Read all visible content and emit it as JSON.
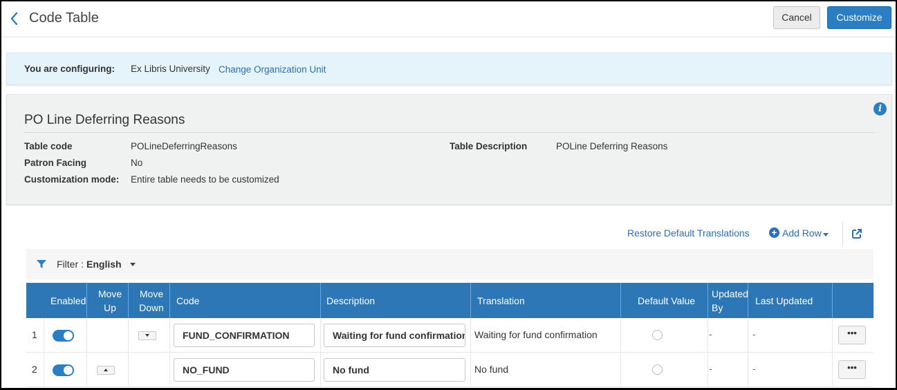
{
  "header": {
    "title": "Code Table",
    "cancel_label": "Cancel",
    "customize_label": "Customize"
  },
  "config": {
    "label": "You are configuring:",
    "value": "Ex Libris University",
    "change_link": "Change Organization Unit"
  },
  "info": {
    "title": "PO Line Deferring Reasons",
    "table_code_label": "Table code",
    "table_code_value": "POLineDeferringReasons",
    "patron_facing_label": "Patron Facing",
    "patron_facing_value": "No",
    "customization_mode_label": "Customization mode:",
    "customization_mode_value": "Entire table needs to be customized",
    "table_description_label": "Table Description",
    "table_description_value": "POLine Deferring Reasons"
  },
  "toolbar": {
    "restore_label": "Restore Default Translations",
    "add_row_label": "Add Row"
  },
  "filter": {
    "label": "Filter :",
    "value": "English"
  },
  "table": {
    "columns": {
      "enabled": "Enabled",
      "move_up_1": "Move",
      "move_up_2": "Up",
      "move_down_1": "Move",
      "move_down_2": "Down",
      "code": "Code",
      "description": "Description",
      "translation": "Translation",
      "default_value": "Default Value",
      "updated_by_1": "Updated",
      "updated_by_2": "By",
      "last_updated": "Last Updated"
    },
    "rows": [
      {
        "num": "1",
        "code": "FUND_CONFIRMATION",
        "description": "Waiting for fund confirmation",
        "translation": "Waiting for fund confirmation",
        "updated_by": "-",
        "last_updated": "-",
        "more": "•••"
      },
      {
        "num": "2",
        "code": "NO_FUND",
        "description": "No fund",
        "translation": "No fund",
        "updated_by": "-",
        "last_updated": "-",
        "more": "•••"
      }
    ]
  },
  "colors": {
    "accent": "#2b7ec1",
    "header_bg": "#2d77b6",
    "link": "#2a6fb5",
    "config_bg": "#e4f4fa",
    "info_bg": "#f0f2f2"
  }
}
